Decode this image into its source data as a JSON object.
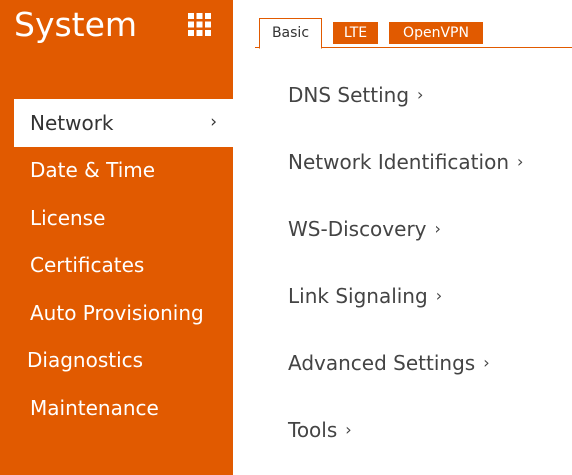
{
  "app": {
    "title": "System",
    "menu_icon": "apps-grid-icon"
  },
  "sidebar": {
    "items": [
      {
        "label": "Network",
        "active": true,
        "chevron": "›"
      },
      {
        "label": "Date & Time"
      },
      {
        "label": "License"
      },
      {
        "label": "Certificates"
      },
      {
        "label": "Auto Provisioning"
      },
      {
        "label": "Diagnostics"
      },
      {
        "label": "Maintenance"
      }
    ]
  },
  "tabs": [
    {
      "label": "Basic",
      "active": true
    },
    {
      "label": "LTE"
    },
    {
      "label": "OpenVPN"
    }
  ],
  "sections": [
    {
      "label": "DNS Setting",
      "chevron": "›"
    },
    {
      "label": "Network Identification",
      "chevron": "›"
    },
    {
      "label": "WS-Discovery",
      "chevron": "›"
    },
    {
      "label": "Link Signaling",
      "chevron": "›"
    },
    {
      "label": "Advanced Settings",
      "chevron": "›"
    },
    {
      "label": "Tools",
      "chevron": "›"
    }
  ],
  "colors": {
    "accent": "#e15a00",
    "text": "#444444",
    "background": "#ffffff"
  }
}
